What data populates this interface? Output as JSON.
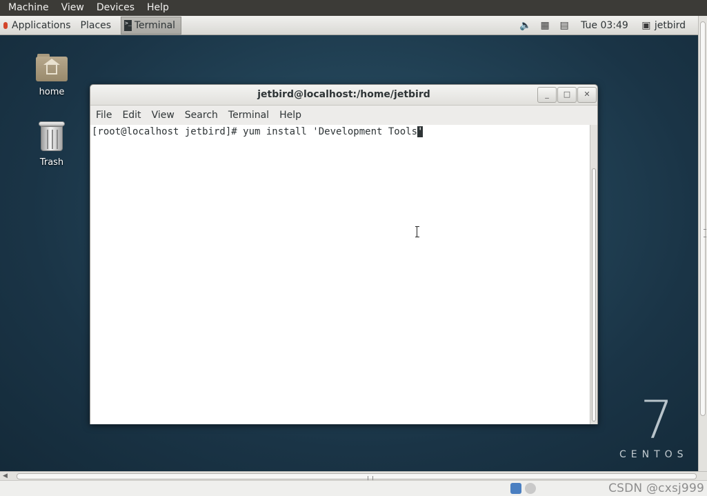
{
  "host_menubar": {
    "items": [
      "Machine",
      "View",
      "Devices",
      "Help"
    ]
  },
  "top_panel": {
    "applications_label": "Applications",
    "places_label": "Places",
    "task_button_label": "Terminal",
    "clock": "Tue 03:49",
    "user": "jetbird",
    "icons": [
      "volume-icon",
      "network-icon",
      "clipboard-icon",
      "user-icon"
    ]
  },
  "desktop": {
    "icons": [
      {
        "label": "home",
        "icon": "home-folder-icon"
      },
      {
        "label": "Trash",
        "icon": "trash-icon"
      }
    ],
    "logo": {
      "number": "7",
      "word": "CENTOS"
    }
  },
  "terminal": {
    "title": "jetbird@localhost:/home/jetbird",
    "menu": [
      "File",
      "Edit",
      "View",
      "Search",
      "Terminal",
      "Help"
    ],
    "prompt": "[root@localhost jetbird]# yum install 'Development Tools",
    "cursor_char": "'"
  },
  "statusbar": {
    "watermark": "CSDN @cxsj999"
  }
}
